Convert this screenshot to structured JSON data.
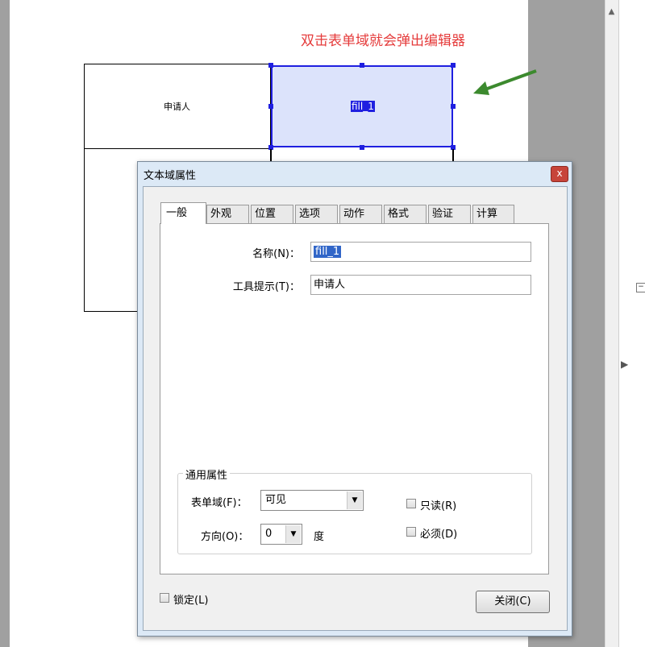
{
  "annotation": "双击表单域就会弹出编辑器",
  "form": {
    "label_cell": "申请人",
    "field_name": "fill_1"
  },
  "dialog": {
    "title": "文本域属性",
    "close_x": "x",
    "tabs": [
      "一般",
      "外观",
      "位置",
      "选项",
      "动作",
      "格式",
      "验证",
      "计算"
    ],
    "name_label": "名称(N)：",
    "name_value": "fill_1",
    "tooltip_label": "工具提示(T)：",
    "tooltip_value": "申请人",
    "common_group_title": "通用属性",
    "form_field_label": "表单域(F)：",
    "form_field_value": "可见",
    "direction_label": "方向(O)：",
    "direction_value": "0",
    "direction_unit": "度",
    "readonly_label": "只读(R)",
    "required_label": "必须(D)",
    "lock_label": "锁定(L)",
    "close_button": "关闭(C)"
  },
  "colors": {
    "annotation": "#e53b3b",
    "selection": "#1f1fe0",
    "field_fill": "#dce3fb",
    "arrow": "#3c8a2e"
  }
}
